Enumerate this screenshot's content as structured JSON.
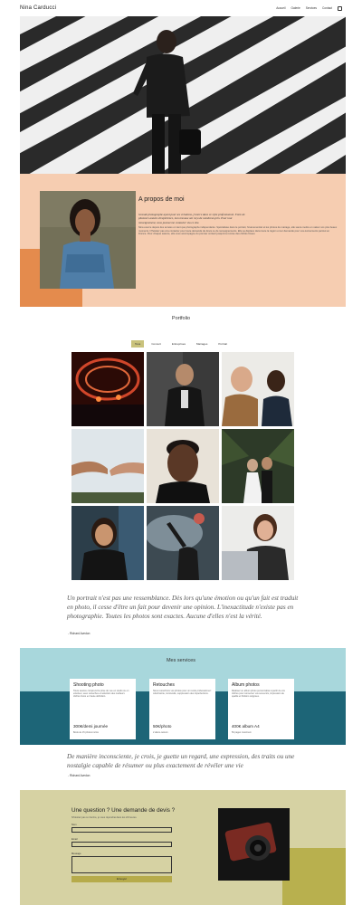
{
  "header": {
    "brand": "Nina Carducci",
    "nav": [
      "Accueil",
      "Galerie",
      "Services",
      "Contact"
    ]
  },
  "about": {
    "title": "A propos de moi",
    "lead": "Grande photographe ayant pour ses créations, j'exerce dans ce style professionnel. Forte de plusieurs années d'expérience, mes travaux ont reçu de nombreux prix. Pour tout renseignement, vous pouvez me contacter via ce site.",
    "body": "Nina exerce depuis des années en tant que photographe indépendante. Spécialisée dans le portrait, l'événementiel et les photos de mariage, elle saura mettre en valeur vos plus beaux moments. N'hésitez pas à la contacter pour toute demande de devis ou de renseignements. Elle se déplace dans toute la région et sur demande pour vos événements partout en France. Pour chaque séance, elle vous accompagne du premier contact jusqu'à la remise des clichés finaux."
  },
  "portfolio": {
    "title": "Portfolio",
    "filters": [
      "Tous",
      "Concert",
      "Entreprises",
      "Mariages",
      "Portrait"
    ],
    "active_filter": "Tous"
  },
  "quote1": {
    "text": "Un portrait n'est pas une ressemblance. Dès lors qu'une émotion ou qu'un fait est traduit en photo, il cesse d'être un fait pour devenir une opinion. L'inexactitude n'existe pas en photographie. Toutes les photos sont exactes. Aucune d'elles n'est la vérité.",
    "author": "- Richard Avedon"
  },
  "services": {
    "title": "Mes services",
    "cards": [
      {
        "title": "Shooting photo",
        "desc": "Toute séance comprend la prise de vue en studio ou en extérieur, avec retouches et sélection des meilleurs clichés livrés en haute définition.",
        "price": "300€/demi journée",
        "note": "Book de 15 photos inclus"
      },
      {
        "title": "Retouches",
        "desc": "Nous retouchons vos photos pour un rendu professionnel : colorimétrie, luminosité, suppression des imperfections.",
        "price": "50€/photo",
        "note": "2 allers-retours"
      },
      {
        "title": "Album photos",
        "desc": "Réalisez un album photo personnalisé à partir de vos clichés pour conserver vos souvenirs, impression de qualité et finitions soignées.",
        "price": "400€ album A4",
        "note": "50 pages maximum"
      }
    ]
  },
  "quote2": {
    "text": "De manière inconsciente, je crois, je guette un regard, une expression, des traits ou une nostalgie capable de résumer ou plus exactement de révéler une vie",
    "author": "- Richard Avedon"
  },
  "contact": {
    "title": "Une question ? Une demande de devis ?",
    "subtitle": "N'hésitez pas à m'écrire, je vous répondrai dans les 24 heures.",
    "name_label": "Nom",
    "email_label": "Email",
    "message_label": "Message",
    "submit_label": "Envoyer"
  },
  "colors": {
    "about_bg": "#f6cdb1",
    "about_accent": "#e48b4d",
    "services_bg": "#a8d7dc",
    "services_band": "#1d6577",
    "contact_bg": "#d6d2a3",
    "contact_accent": "#b8b04e",
    "filter_active": "#c9c27c"
  }
}
